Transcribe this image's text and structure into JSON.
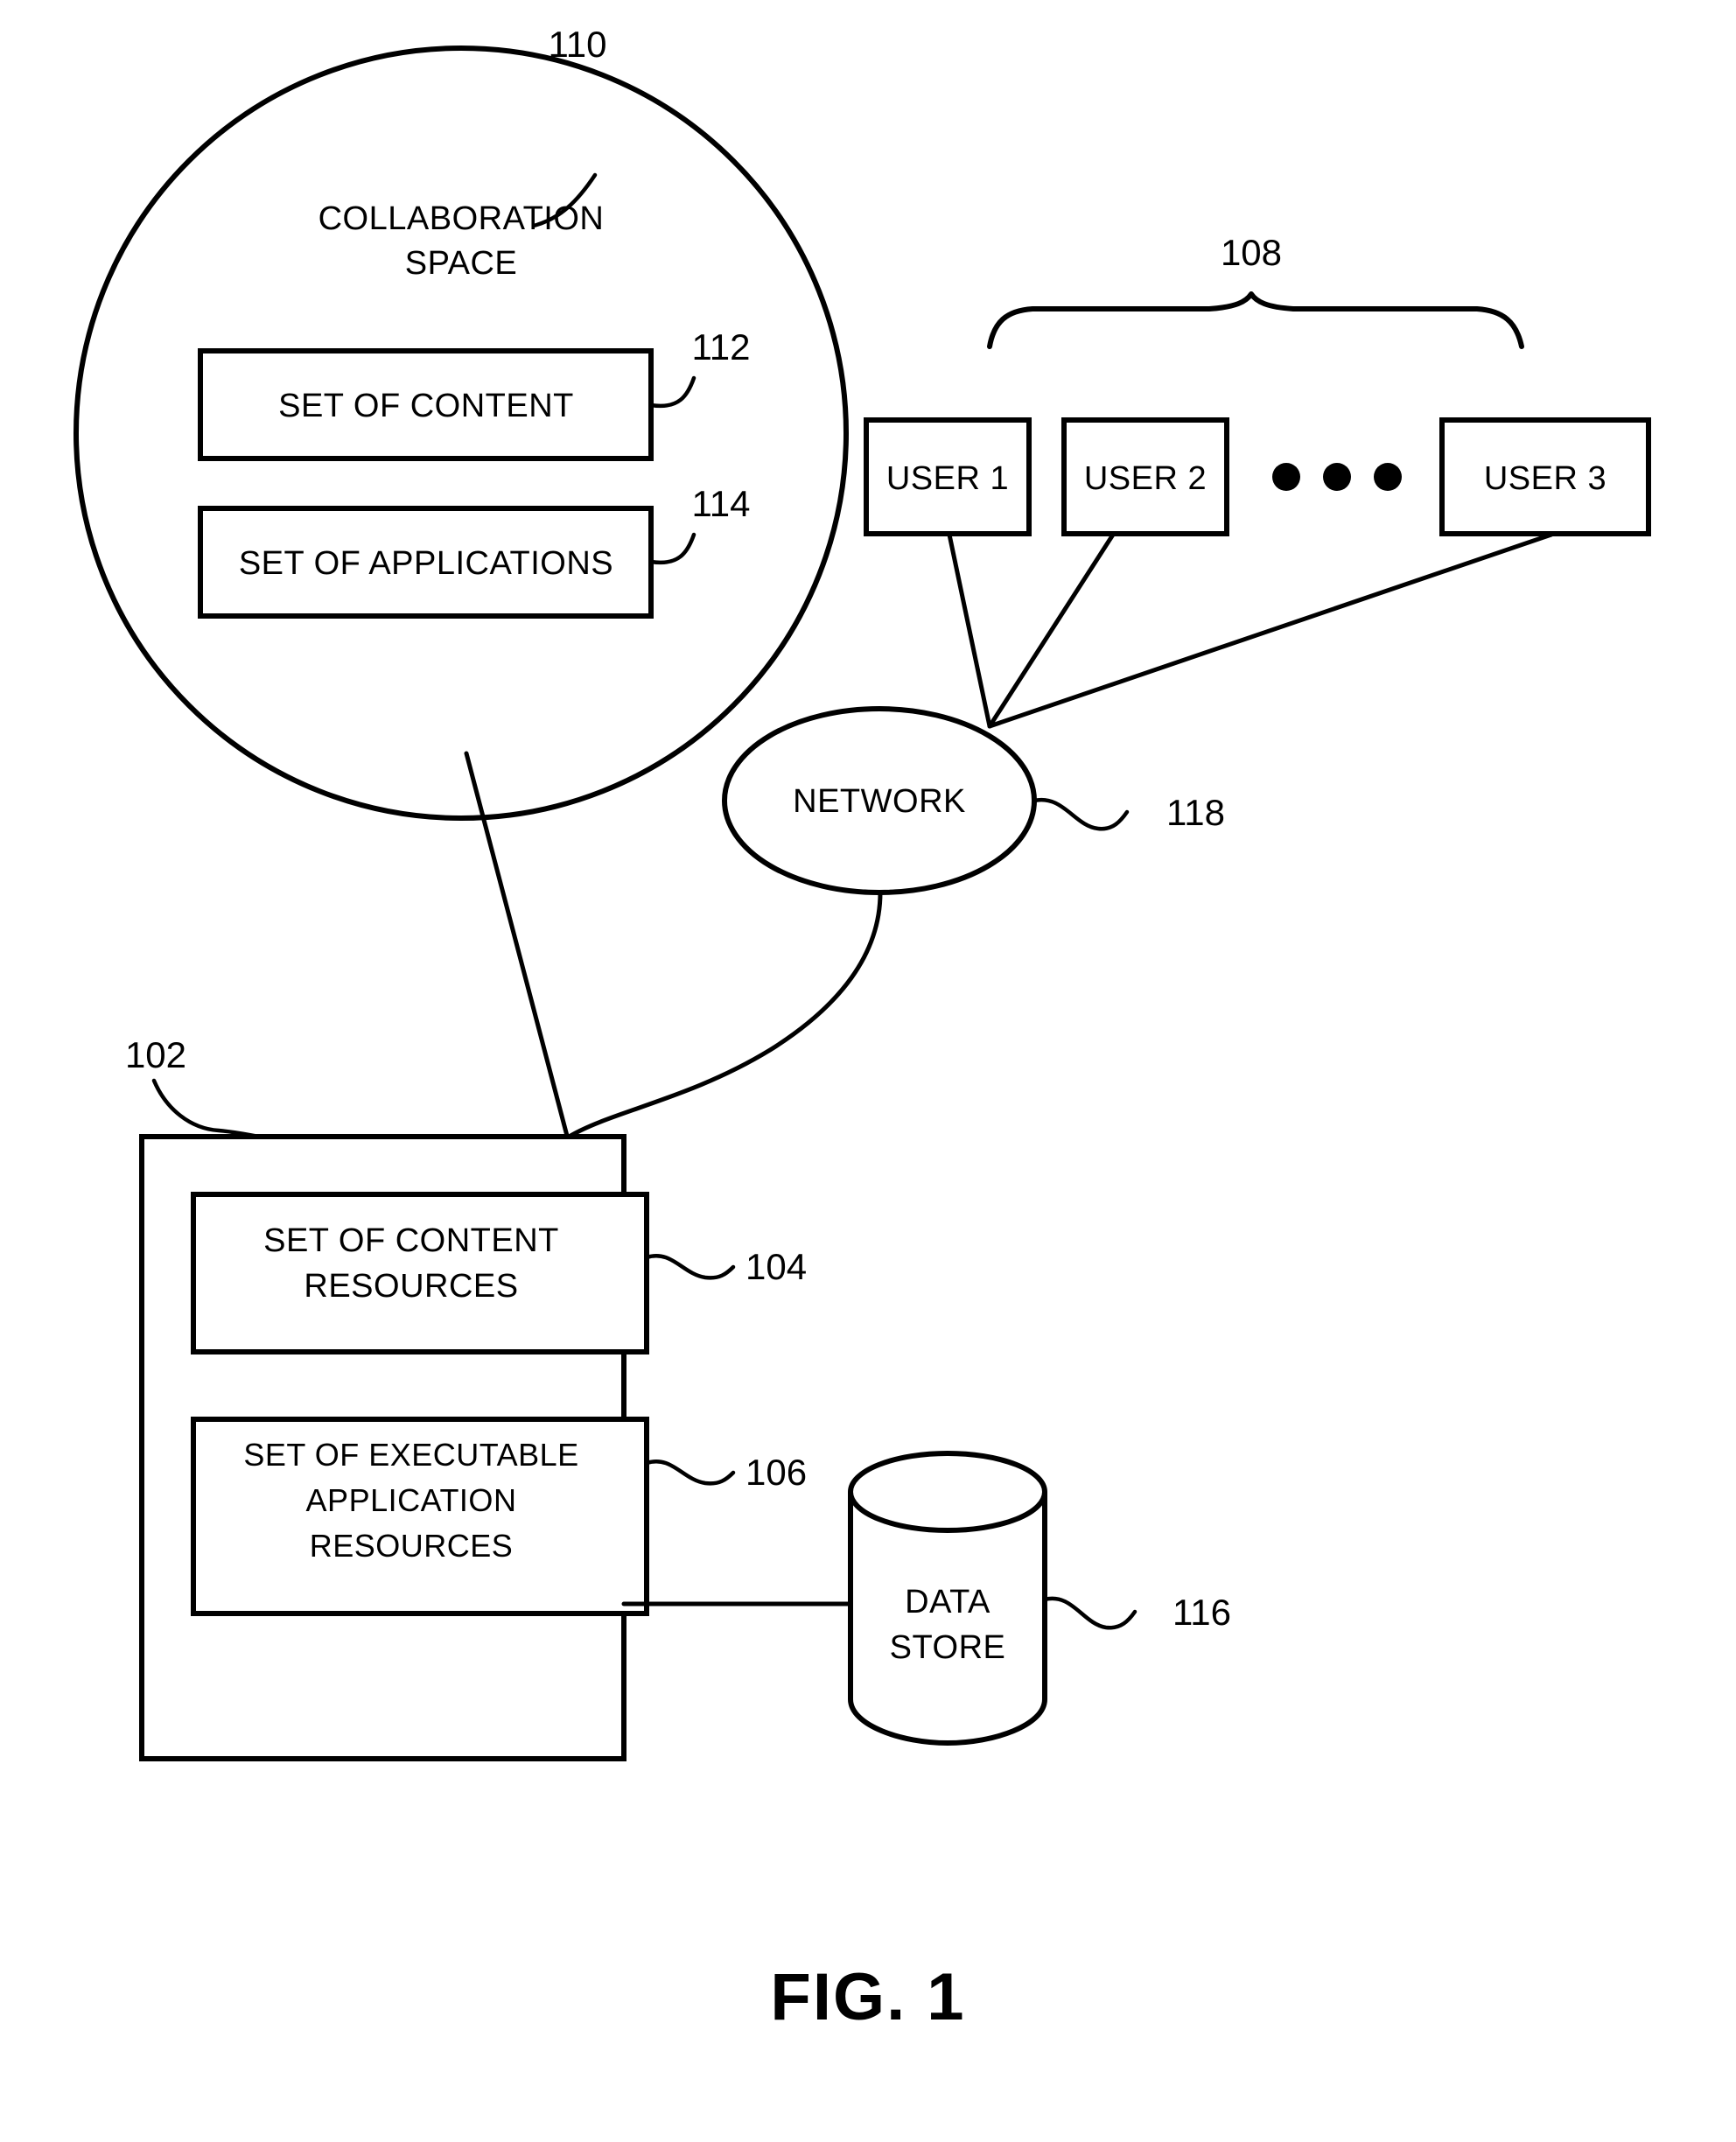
{
  "figure": {
    "caption": "FIG. 1",
    "background_color": "#ffffff",
    "line_color": "#000000"
  },
  "collaboration_space": {
    "ref": "110",
    "title_line1": "COLLABORATION",
    "title_line2": "SPACE",
    "boxes": [
      {
        "ref": "112",
        "label": "SET OF CONTENT"
      },
      {
        "ref": "114",
        "label": "SET OF APPLICATIONS"
      }
    ]
  },
  "users": {
    "ref": "108",
    "ellipsis": "• • •",
    "items": [
      {
        "label": "USER 1"
      },
      {
        "label": "USER 2"
      },
      {
        "label": "USER 3"
      }
    ]
  },
  "network": {
    "ref": "118",
    "label": "NETWORK"
  },
  "server": {
    "ref": "102",
    "boxes": [
      {
        "ref": "104",
        "label_line1": "SET OF CONTENT",
        "label_line2": "RESOURCES"
      },
      {
        "ref": "106",
        "label_line1": "SET OF EXECUTABLE",
        "label_line2": "APPLICATION",
        "label_line3": "RESOURCES"
      }
    ]
  },
  "data_store": {
    "ref": "116",
    "label_line1": "DATA",
    "label_line2": "STORE"
  }
}
